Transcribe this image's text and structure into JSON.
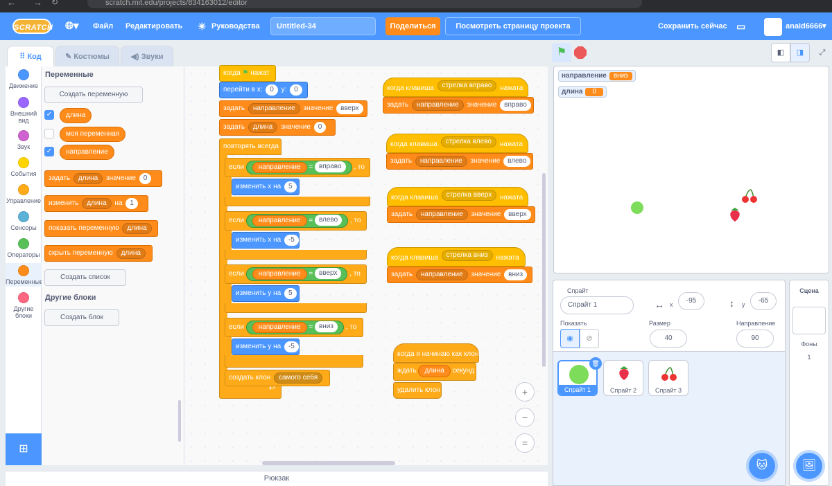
{
  "browser": {
    "url": "scratch.mit.edu/projects/834163012/editor"
  },
  "menubar": {
    "logo": "SCRATCH",
    "file": "Файл",
    "edit": "Редактировать",
    "tutorials": "Руководства",
    "project_title": "Untitled-34",
    "share": "Поделиться",
    "see_project": "Посмотреть страницу проекта",
    "save_now": "Сохранить сейчас",
    "username": "anaid6666"
  },
  "tabs": [
    {
      "label": "Код",
      "icon": "code-icon"
    },
    {
      "label": "Костюмы",
      "icon": "brush-icon"
    },
    {
      "label": "Звуки",
      "icon": "speaker-icon"
    }
  ],
  "categories": [
    {
      "label": "Движение",
      "color": "#4c97ff"
    },
    {
      "label": "Внешний вид",
      "color": "#9966ff"
    },
    {
      "label": "Звук",
      "color": "#cf63cf"
    },
    {
      "label": "События",
      "color": "#ffd500"
    },
    {
      "label": "Управление",
      "color": "#ffab19"
    },
    {
      "label": "Сенсоры",
      "color": "#5cb1d6"
    },
    {
      "label": "Операторы",
      "color": "#59c059"
    },
    {
      "label": "Переменные",
      "color": "#ff8c1a"
    },
    {
      "label": "Другие блоки",
      "color": "#ff6680"
    }
  ],
  "palette": {
    "section_variables": "Переменные",
    "make_variable": "Создать переменную",
    "vars": [
      {
        "name": "длина",
        "checked": true
      },
      {
        "name": "моя переменная",
        "checked": false
      },
      {
        "name": "направление",
        "checked": true
      }
    ],
    "blocks": {
      "set": "задать",
      "set_var": "длина",
      "set_to": "значение",
      "set_val": "0",
      "change": "изменить",
      "change_var": "длина",
      "change_by": "на",
      "change_val": "1",
      "show": "показать переменную",
      "show_var": "длина",
      "hide": "скрыть переменную",
      "hide_var": "длина"
    },
    "make_list": "Создать список",
    "section_more": "Другие блоки",
    "make_block": "Создать блок"
  },
  "script1": {
    "hat": "когда",
    "hat2": "нажат",
    "goto": "перейти в x:",
    "gx": "0",
    "gy_label": "y:",
    "gy": "0",
    "set1": "задать",
    "set1_var": "направление",
    "set1_to": "значение",
    "set1_val": "вверх",
    "set2": "задать",
    "set2_var": "длина",
    "set2_to": "значение",
    "set2_val": "0",
    "forever": "повторять всегда",
    "if_label": "если",
    "then_label": ", то",
    "eq": "=",
    "dir_var": "направление",
    "if1_val": "вправо",
    "body1": "изменить х на",
    "body1_val": "5",
    "if2_val": "влево",
    "body2": "изменить х на",
    "body2_val": "-5",
    "if3_val": "вверх",
    "body3": "изменить у на",
    "body3_val": "5",
    "if4_val": "вниз",
    "body4": "изменить у на",
    "body4_val": "-5",
    "clone": "создать клон",
    "clone_of": "самого себя"
  },
  "keyscripts": [
    {
      "when": "когда клавиша",
      "key": "стрелка вправо",
      "pressed": "нажата",
      "set": "задать",
      "var": "направление",
      "to": "значение",
      "val": "вправо"
    },
    {
      "when": "когда клавиша",
      "key": "стрелка влево",
      "pressed": "нажата",
      "set": "задать",
      "var": "направление",
      "to": "значение",
      "val": "влево"
    },
    {
      "when": "когда клавиша",
      "key": "стрелка вверх",
      "pressed": "нажата",
      "set": "задать",
      "var": "направление",
      "to": "значение",
      "val": "вверх"
    },
    {
      "when": "когда клавиша",
      "key": "стрелка вниз",
      "pressed": "нажата",
      "set": "задать",
      "var": "направление",
      "to": "значение",
      "val": "вниз"
    }
  ],
  "clonescript": {
    "hat": "когда я начинаю как клон",
    "wait": "ждать",
    "wait_var": "длина",
    "wait_unit": "секунд",
    "delete": "удалить клон"
  },
  "zoom": {
    "in": "+",
    "out": "−",
    "reset": "="
  },
  "backpack": "Рюкзак",
  "stage": {
    "monitors": [
      {
        "label": "направление",
        "value": "вниз"
      },
      {
        "label": "длина",
        "value": "0"
      }
    ]
  },
  "sprite_info": {
    "sprite_label": "Спрайт",
    "sprite_name": "Спрайт 1",
    "x_label": "x",
    "x": "-95",
    "y_label": "y",
    "y": "-65",
    "show_label": "Показать",
    "size_label": "Размер",
    "size": "40",
    "direction_label": "Направление",
    "direction": "90"
  },
  "sprites": [
    {
      "name": "Спрайт 1",
      "selected": true
    },
    {
      "name": "Спрайт 2",
      "selected": false
    },
    {
      "name": "Спрайт 3",
      "selected": false
    }
  ],
  "stage_panel": {
    "title": "Сцена",
    "backdrops_label": "Фоны",
    "backdrops_count": "1"
  },
  "colors": {
    "accent": "#4c97ff",
    "variables": "#ff8c1a",
    "events": "#ffbf00",
    "control": "#ffab19",
    "operators": "#59c059"
  }
}
